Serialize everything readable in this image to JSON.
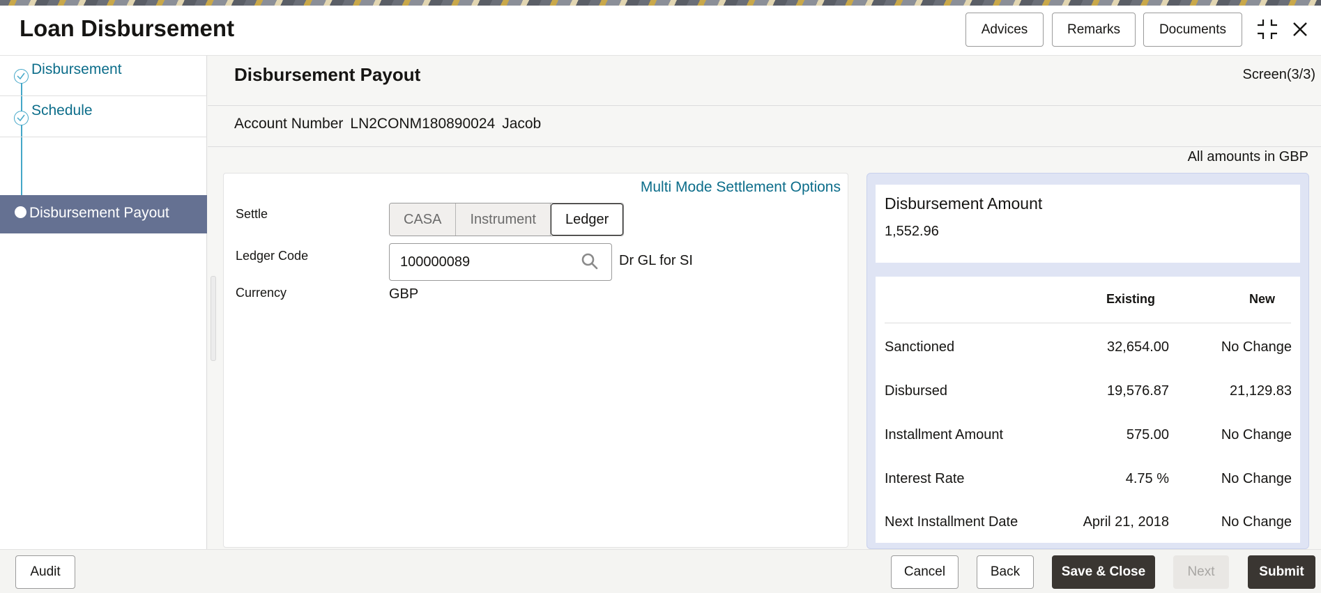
{
  "app": {
    "title": "Loan Disbursement",
    "header_buttons": {
      "advices": "Advices",
      "remarks": "Remarks",
      "documents": "Documents"
    }
  },
  "sidebar": {
    "steps": [
      {
        "label": "Disbursement",
        "state": "completed"
      },
      {
        "label": "Schedule",
        "state": "completed"
      },
      {
        "label": "Disbursement Payout",
        "state": "active"
      }
    ]
  },
  "main": {
    "title": "Disbursement Payout",
    "screen_indicator": "Screen(3/3)",
    "account": {
      "label": "Account Number",
      "number": "LN2CONM180890024",
      "name": "Jacob"
    },
    "amounts_note": "All amounts in GBP"
  },
  "settlement": {
    "multi_mode_link": "Multi Mode Settlement Options",
    "settle_label": "Settle",
    "settle_options": [
      "CASA",
      "Instrument",
      "Ledger"
    ],
    "settle_selected": "Ledger",
    "ledger_code_label": "Ledger Code",
    "ledger_code_value": "100000089",
    "ledger_code_desc": "Dr GL for SI",
    "currency_label": "Currency",
    "currency_value": "GBP"
  },
  "summary": {
    "disbursement_amount_label": "Disbursement Amount",
    "disbursement_amount_value": "1,552.96",
    "columns": {
      "existing": "Existing",
      "new": "New"
    },
    "rows": [
      {
        "label": "Sanctioned",
        "existing": "32,654.00",
        "new": "No Change"
      },
      {
        "label": "Disbursed",
        "existing": "19,576.87",
        "new": "21,129.83"
      },
      {
        "label": "Installment Amount",
        "existing": "575.00",
        "new": "No Change"
      },
      {
        "label": "Interest Rate",
        "existing": "4.75 %",
        "new": "No Change"
      },
      {
        "label": "Next Installment Date",
        "existing": "April 21, 2018",
        "new": "No Change"
      }
    ]
  },
  "footer": {
    "audit": "Audit",
    "cancel": "Cancel",
    "back": "Back",
    "save_close": "Save & Close",
    "next": "Next",
    "submit": "Submit"
  },
  "colors": {
    "link": "#0c6d8a",
    "active_step": "#657192",
    "primary_button": "#3a3632",
    "summary_bg": "#dfe4f4"
  },
  "icons": {
    "fullscreen": "collapse-icon",
    "close": "close-icon",
    "search": "search-icon",
    "step_done": "check-circle-icon"
  }
}
